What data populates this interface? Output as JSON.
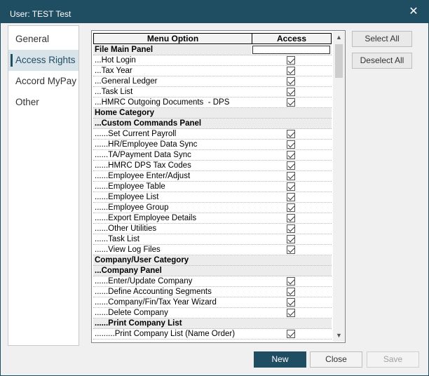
{
  "window": {
    "title": "User: TEST Test",
    "close_glyph": "✕"
  },
  "sidebar": {
    "items": [
      {
        "label": "General",
        "active": false
      },
      {
        "label": "Access Rights",
        "active": true
      },
      {
        "label": "Accord MyPay",
        "active": false
      },
      {
        "label": "Other",
        "active": false
      }
    ]
  },
  "grid": {
    "columns": {
      "menu": "Menu Option",
      "access": "Access"
    },
    "rows": [
      {
        "label": "File Main Panel",
        "bold": true,
        "type": "category"
      },
      {
        "label": "...Hot Login",
        "checked": true
      },
      {
        "label": "...Tax Year",
        "checked": true
      },
      {
        "label": "...General Ledger",
        "checked": true
      },
      {
        "label": "...Task List",
        "checked": true
      },
      {
        "label": "...HMRC Outgoing Documents  - DPS",
        "checked": true
      },
      {
        "label": "Home Category",
        "bold": true,
        "type": "category"
      },
      {
        "label": "...Custom Commands Panel",
        "bold": true,
        "type": "category"
      },
      {
        "label": "......Set Current Payroll",
        "checked": true
      },
      {
        "label": "......HR/Employee Data Sync",
        "checked": true
      },
      {
        "label": "......TA/Payment Data Sync",
        "checked": true
      },
      {
        "label": "......HMRC DPS Tax Codes",
        "checked": true
      },
      {
        "label": "......Employee Enter/Adjust",
        "checked": true
      },
      {
        "label": "......Employee Table",
        "checked": true
      },
      {
        "label": "......Employee List",
        "checked": true
      },
      {
        "label": "......Employee Group",
        "checked": true
      },
      {
        "label": "......Export Employee Details",
        "checked": true
      },
      {
        "label": "......Other Utilities",
        "checked": true
      },
      {
        "label": "......Task List",
        "checked": true
      },
      {
        "label": "......View Log Files",
        "checked": true
      },
      {
        "label": "Company/User Category",
        "bold": true,
        "type": "category"
      },
      {
        "label": "...Company Panel",
        "bold": true,
        "type": "category"
      },
      {
        "label": "......Enter/Update Company",
        "checked": true
      },
      {
        "label": "......Define Accounting Segments",
        "checked": true
      },
      {
        "label": "......Company/Fin/Tax Year Wizard",
        "checked": true
      },
      {
        "label": "......Delete Company",
        "checked": true
      },
      {
        "label": "......Print Company List",
        "bold": true,
        "type": "category"
      },
      {
        "label": ".........Print Company List (Name Order)",
        "checked": true
      }
    ]
  },
  "scrollbar": {
    "up_glyph": "▲",
    "down_glyph": "▼"
  },
  "actions": {
    "select_all": "Select All",
    "deselect_all": "Deselect All"
  },
  "footer": {
    "new": "New",
    "close": "Close",
    "save": "Save"
  },
  "colors": {
    "titlebar": "#1f4e63",
    "primary_button": "#1f4e63",
    "active_nav": "#d9e3ea"
  }
}
